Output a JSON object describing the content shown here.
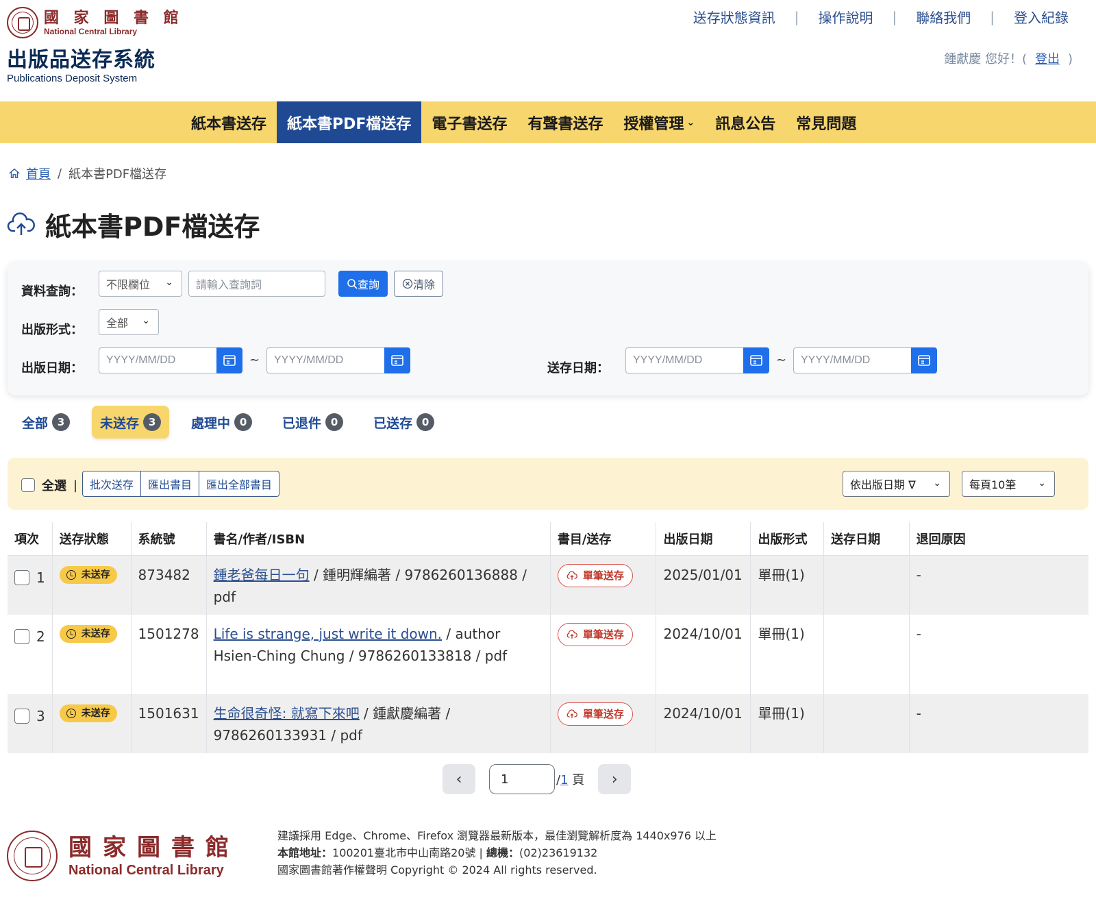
{
  "header": {
    "lib_cn": "國 家 圖 書 館",
    "lib_en": "National Central Library",
    "system_title": "出版品送存系統",
    "system_subtitle": "Publications Deposit System",
    "top_links": [
      "送存狀態資訊",
      "操作說明",
      "聯絡我們",
      "登入紀錄"
    ],
    "greeting": "鍾獻慶 您好！(",
    "logout": "登出",
    "greeting_close": ")"
  },
  "nav": {
    "items": [
      "紙本書送存",
      "紙本書PDF檔送存",
      "電子書送存",
      "有聲書送存",
      "授權管理",
      "訊息公告",
      "常見問題"
    ],
    "active_index": 1
  },
  "breadcrumb": {
    "home": "首頁",
    "separator": "/",
    "current": "紙本書PDF檔送存"
  },
  "page_title": "紙本書PDF檔送存",
  "search": {
    "query_label": "資料查詢：",
    "field_select": "不限欄位",
    "query_placeholder": "請輸入查詢詞",
    "query_button": "查詢",
    "clear_button": "清除",
    "format_label": "出版形式：",
    "format_select": "全部",
    "pub_date_label": "出版日期：",
    "deposit_date_label": "送存日期：",
    "date_placeholder": "YYYY/MM/DD",
    "tilde": "~"
  },
  "tabs": [
    {
      "label": "全部",
      "count": "3"
    },
    {
      "label": "未送存",
      "count": "3"
    },
    {
      "label": "處理中",
      "count": "0"
    },
    {
      "label": "已退件",
      "count": "0"
    },
    {
      "label": "已送存",
      "count": "0"
    }
  ],
  "toolbar": {
    "select_all": "全選",
    "bar": "|",
    "batch_send": "批次送存",
    "export_list": "匯出書目",
    "export_all": "匯出全部書目",
    "sort_select": "依出版日期 ∇",
    "page_size_select": "每頁10筆"
  },
  "table": {
    "headers": [
      "項次",
      "送存狀態",
      "系統號",
      "書名/作者/ISBN",
      "書目/送存",
      "出版日期",
      "出版形式",
      "送存日期",
      "退回原因"
    ],
    "rows": [
      {
        "index": "1",
        "status": "未送存",
        "sys_no": "873482",
        "title": "鍾老爸每日一句",
        "rest": " / 鍾明輝編著 / 9786260136888 / pdf",
        "send": "單筆送存",
        "pub_date": "2025/01/01",
        "format": "單冊(1)",
        "deposit_date": "",
        "reason": "-"
      },
      {
        "index": "2",
        "status": "未送存",
        "sys_no": "1501278",
        "title": "Life is strange, just write it down.",
        "rest": " / author Hsien-Ching Chung / 9786260133818 / pdf",
        "send": "單筆送存",
        "pub_date": "2024/10/01",
        "format": "單冊(1)",
        "deposit_date": "",
        "reason": "-"
      },
      {
        "index": "3",
        "status": "未送存",
        "sys_no": "1501631",
        "title": "生命很奇怪: 就寫下來吧",
        "rest": " / 鍾獻慶編著 / 9786260133931 / pdf",
        "send": "單筆送存",
        "pub_date": "2024/10/01",
        "format": "單冊(1)",
        "deposit_date": "",
        "reason": "-"
      }
    ]
  },
  "pager": {
    "current": "1",
    "slash": "/",
    "total": "1",
    "unit": "頁"
  },
  "footer": {
    "lib_cn": "國家圖書館",
    "lib_en": "National Central Library",
    "line1": "建議採用 Edge、Chrome、Firefox 瀏覽器最新版本，最佳瀏覽解析度為 1440x976 以上",
    "addr_label": "本館地址：",
    "addr": "100201臺北市中山南路20號",
    "sep": " | ",
    "phone_label": "總機：",
    "phone": "(02)23619132",
    "line3": "國家圖書館著作權聲明 Copyright © 2024 All rights reserved."
  }
}
